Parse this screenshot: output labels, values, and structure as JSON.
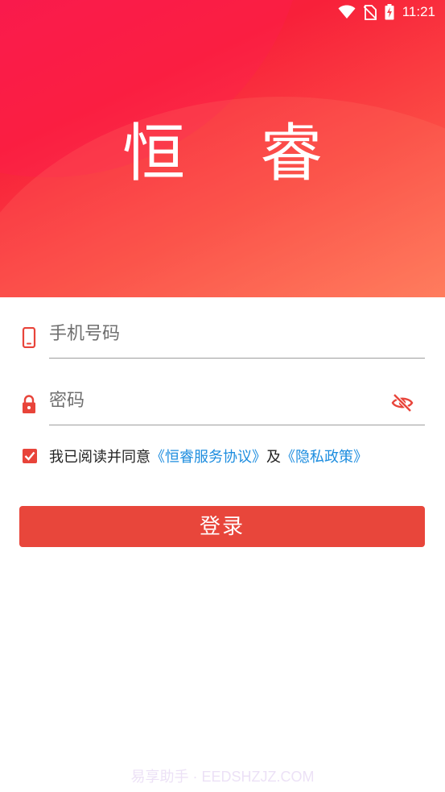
{
  "status_bar": {
    "time": "11:21",
    "icons": [
      "wifi-icon",
      "no-sim-icon",
      "battery-charging-icon"
    ]
  },
  "app": {
    "title": "恒 睿"
  },
  "form": {
    "phone_placeholder": "手机号码",
    "phone_value": "",
    "password_placeholder": "密码",
    "password_value": "",
    "password_visibility_icon": "eye-off-icon"
  },
  "agreement": {
    "checked": true,
    "prefix": "我已阅读并同意",
    "service_link": "《恒睿服务协议》",
    "conjunction": "及",
    "privacy_link": "《隐私政策》"
  },
  "login_button": {
    "label": "登录"
  },
  "watermark": {
    "text": "易享助手 · EEDSHZJZ.COM"
  },
  "colors": {
    "brand_red": "#e8463b",
    "link_blue": "#1d8ddf",
    "icon_red": "#e8443a"
  }
}
